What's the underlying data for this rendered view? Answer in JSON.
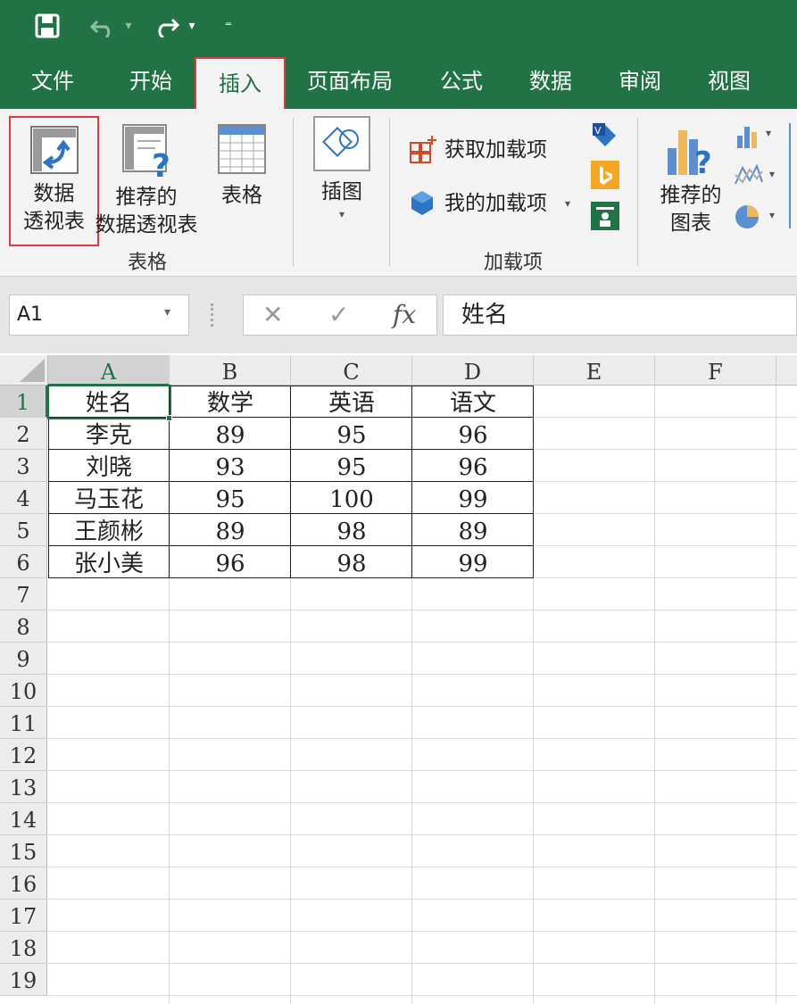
{
  "qat": {
    "dropdown_caret": "▾",
    "customize_caret": "⁼"
  },
  "tabs": [
    {
      "label": "文件"
    },
    {
      "label": "开始"
    },
    {
      "label": "插入"
    },
    {
      "label": "页面布局"
    },
    {
      "label": "公式"
    },
    {
      "label": "数据"
    },
    {
      "label": "审阅"
    },
    {
      "label": "视图"
    }
  ],
  "ribbon": {
    "pivot_table": {
      "line1": "数据",
      "line2": "透视表"
    },
    "recommended_pivot": {
      "line1": "推荐的",
      "line2": "数据透视表"
    },
    "table": {
      "label": "表格"
    },
    "tables_group": "表格",
    "illustrations": {
      "label": "插图"
    },
    "get_addins": "获取加载项",
    "my_addins": "我的加载项",
    "addins_group": "加载项",
    "recommended_charts": {
      "line1": "推荐的",
      "line2": "图表"
    }
  },
  "formula_bar": {
    "name_box": "A1",
    "cancel": "✕",
    "enter": "✓",
    "fx": "fx",
    "content": "姓名"
  },
  "sheet": {
    "columns": [
      "A",
      "B",
      "C",
      "D",
      "E",
      "F"
    ],
    "rows": [
      "1",
      "2",
      "3",
      "4",
      "5",
      "6",
      "7",
      "8",
      "9",
      "10",
      "11",
      "12",
      "13",
      "14",
      "15",
      "16",
      "17",
      "18",
      "19"
    ],
    "data": [
      [
        "姓名",
        "数学",
        "英语",
        "语文"
      ],
      [
        "李克",
        "89",
        "95",
        "96"
      ],
      [
        "刘晓",
        "93",
        "95",
        "96"
      ],
      [
        "马玉花",
        "95",
        "100",
        "99"
      ],
      [
        "王颜彬",
        "89",
        "98",
        "89"
      ],
      [
        "张小美",
        "96",
        "98",
        "99"
      ]
    ],
    "selected_cell": "A1"
  },
  "colors": {
    "accent": "#217346",
    "highlight": "#e0393e"
  }
}
